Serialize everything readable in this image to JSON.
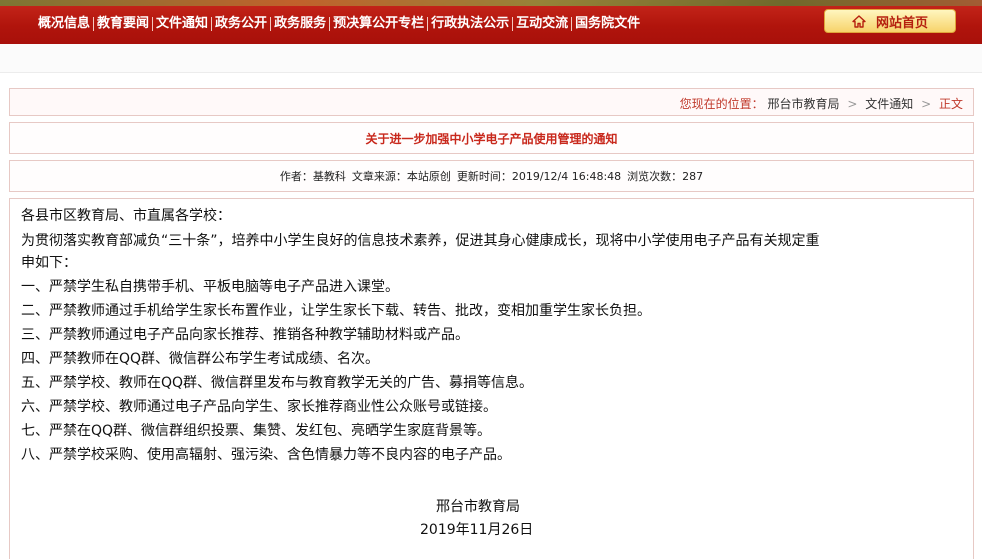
{
  "nav": {
    "items": [
      "概况信息",
      "教育要闻",
      "文件通知",
      "政务公开",
      "政务服务",
      "预决算公开专栏",
      "行政执法公示",
      "互动交流",
      "国务院文件"
    ],
    "home_label": "网站首页",
    "home_icon": "home-icon"
  },
  "breadcrumb": {
    "prefix": "您现在的位置：",
    "items": [
      "邢台市教育局",
      "文件通知",
      "正文"
    ],
    "separator": ">"
  },
  "article": {
    "title": "关于进一步加强中小学电子产品使用管理的通知",
    "meta": {
      "author": "作者：基教科",
      "source": "文章来源：本站原创",
      "updated": "更新时间：2019/12/4 16:48:48",
      "views": "浏览次数：287"
    },
    "greeting": "各县市区教育局、市直属各学校：",
    "intro_line1": "为贯彻落实教育部减负“三十条”，培养中小学生良好的信息技术素养，促进其身心健康成长，现将中小学使用电子产品有关规定重",
    "intro_line2": "申如下：",
    "rules": [
      "一、严禁学生私自携带手机、平板电脑等电子产品进入课堂。",
      "二、严禁教师通过手机给学生家长布置作业，让学生家长下载、转告、批改，变相加重学生家长负担。",
      "三、严禁教师通过电子产品向家长推荐、推销各种教学辅助材料或产品。",
      "四、严禁教师在QQ群、微信群公布学生考试成绩、名次。",
      "五、严禁学校、教师在QQ群、微信群里发布与教育教学无关的广告、募捐等信息。",
      "六、严禁学校、教师通过电子产品向学生、家长推荐商业性公众账号或链接。",
      "七、严禁在QQ群、微信群组织投票、集赞、发红包、亮晒学生家庭背景等。",
      "八、严禁学校采购、使用高辐射、强污染、含色情暴力等不良内容的电子产品。"
    ],
    "signature": "邢台市教育局",
    "date": "2019年11月26日"
  },
  "colors": {
    "nav_red": "#b0140c",
    "title_red": "#c8281c",
    "border_pink": "#e7c9c5"
  }
}
